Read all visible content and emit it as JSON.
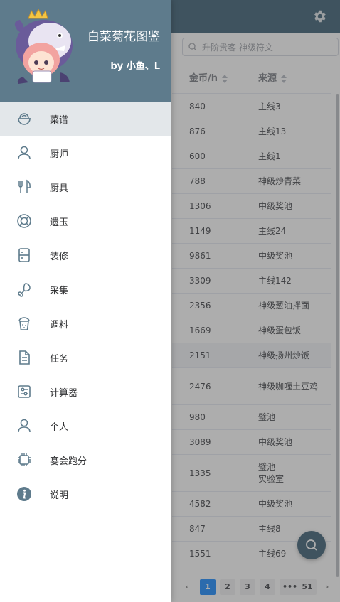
{
  "app": {
    "title": "白菜菊花图鉴",
    "author": "by 小鱼、L"
  },
  "menu": [
    {
      "label": "菜谱",
      "icon": "recipe-bowl-icon",
      "active": true
    },
    {
      "label": "厨师",
      "icon": "person-icon"
    },
    {
      "label": "厨具",
      "icon": "fork-knife-icon"
    },
    {
      "label": "遗玉",
      "icon": "lifebuoy-icon"
    },
    {
      "label": "装修",
      "icon": "cabinet-icon"
    },
    {
      "label": "采集",
      "icon": "drumstick-icon"
    },
    {
      "label": "调料",
      "icon": "seasoning-jar-icon"
    },
    {
      "label": "任务",
      "icon": "document-icon"
    },
    {
      "label": "计算器",
      "icon": "calculator-sliders-icon"
    },
    {
      "label": "个人",
      "icon": "person-icon"
    },
    {
      "label": "宴会跑分",
      "icon": "chip-icon"
    },
    {
      "label": "说明",
      "icon": "info-icon"
    }
  ],
  "search": {
    "placeholder": "升阶贵客 神级符文"
  },
  "table": {
    "columns": [
      "金币/h",
      "来源"
    ],
    "rows": [
      {
        "gold": "840",
        "source": "主线3"
      },
      {
        "gold": "876",
        "source": "主线13"
      },
      {
        "gold": "600",
        "source": "主线1"
      },
      {
        "gold": "788",
        "source": "神级炒青菜"
      },
      {
        "gold": "1306",
        "source": "中级奖池"
      },
      {
        "gold": "1149",
        "source": "主线24"
      },
      {
        "gold": "9861",
        "source": "中级奖池"
      },
      {
        "gold": "3309",
        "source": "主线142"
      },
      {
        "gold": "2356",
        "source": "神级葱油拌面"
      },
      {
        "gold": "1669",
        "source": "神级蛋包饭"
      },
      {
        "gold": "2151",
        "source": "神级扬州炒饭",
        "highlight": true
      },
      {
        "gold": "2476",
        "source": "神级咖喱土豆鸡",
        "tall": true
      },
      {
        "gold": "980",
        "source": "璧池"
      },
      {
        "gold": "3089",
        "source": "中级奖池"
      },
      {
        "gold": "1335",
        "source": "璧池",
        "source2": "实验室",
        "tall": true
      },
      {
        "gold": "4582",
        "source": "中级奖池"
      },
      {
        "gold": "847",
        "source": "主线8"
      },
      {
        "gold": "1551",
        "source": "主线69"
      }
    ]
  },
  "pagination": {
    "pages": [
      "1",
      "2",
      "3",
      "4",
      "•••",
      "51"
    ],
    "current": "1",
    "prev": "‹",
    "next": "›"
  },
  "colors": {
    "header_bg": "#5e7b8c",
    "active_item_bg": "#e3e7ea",
    "accent": "#409eff"
  }
}
